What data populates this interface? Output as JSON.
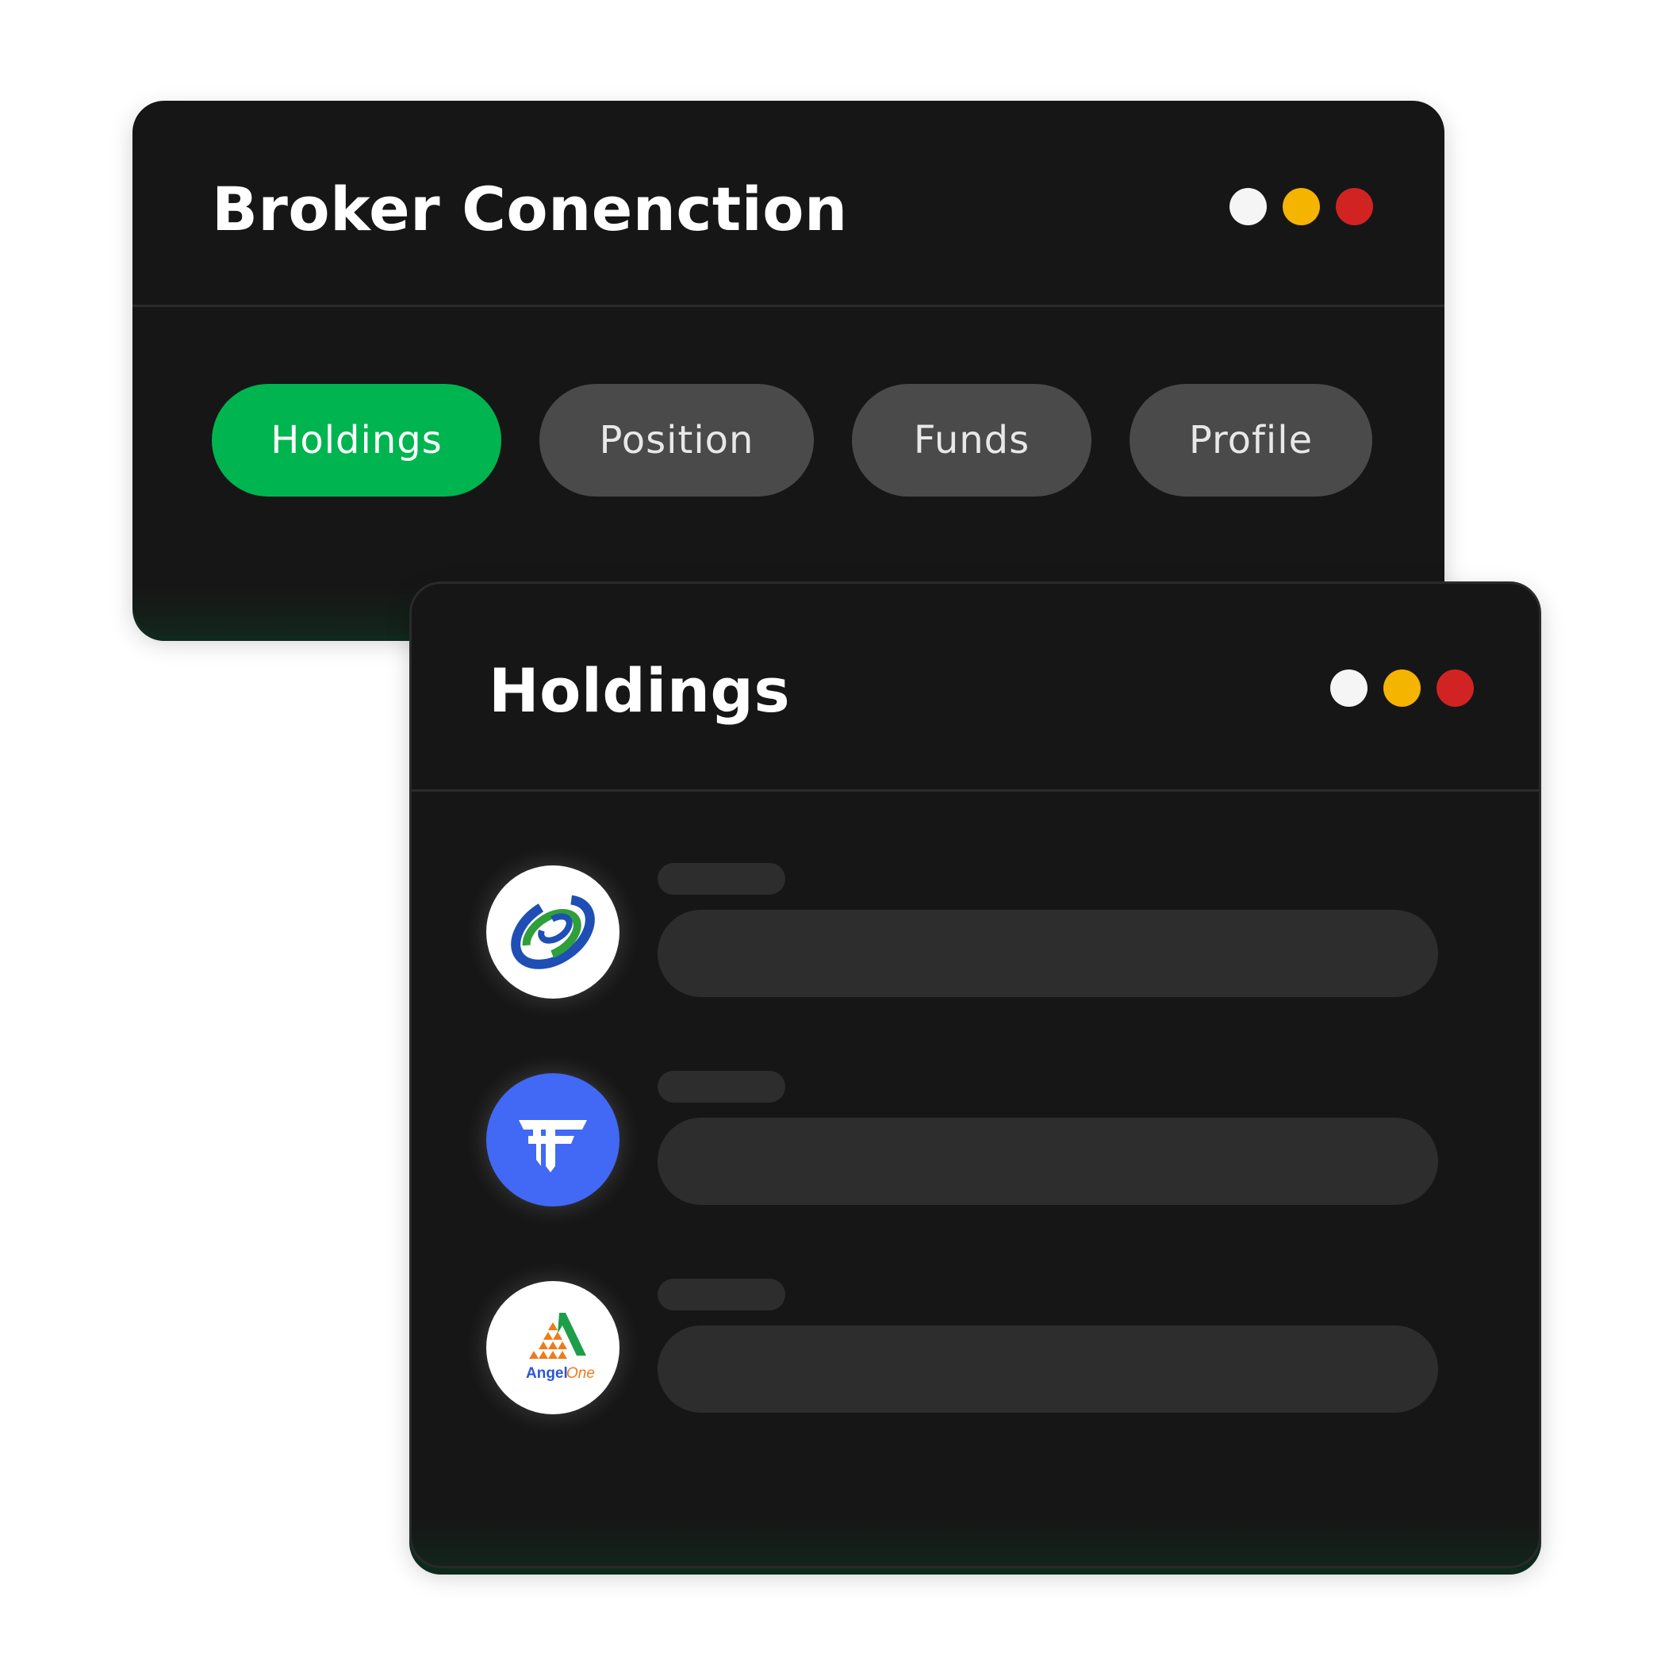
{
  "broker_window": {
    "title": "Broker Conenction",
    "dots": [
      "#f5f5f5",
      "#f5b400",
      "#d22323"
    ],
    "tabs": [
      {
        "label": "Holdings",
        "active": true
      },
      {
        "label": "Position",
        "active": false
      },
      {
        "label": "Funds",
        "active": false
      },
      {
        "label": "Profile",
        "active": false
      }
    ]
  },
  "holdings_window": {
    "title": "Holdings",
    "dots": [
      "#f5f5f5",
      "#f5b400",
      "#d22323"
    ],
    "rows": [
      {
        "logo": "broker-logo-ring-icon"
      },
      {
        "logo": "fyers-logo-icon"
      },
      {
        "logo": "angelone-logo",
        "logo_text_1": "Angel",
        "logo_text_2": "One"
      }
    ]
  },
  "colors": {
    "active_tab": "#00b54f",
    "inactive_tab": "#4a4a4a",
    "window_bg": "#161616",
    "skeleton": "#2d2d2e",
    "fyers_blue": "#4169f5"
  }
}
